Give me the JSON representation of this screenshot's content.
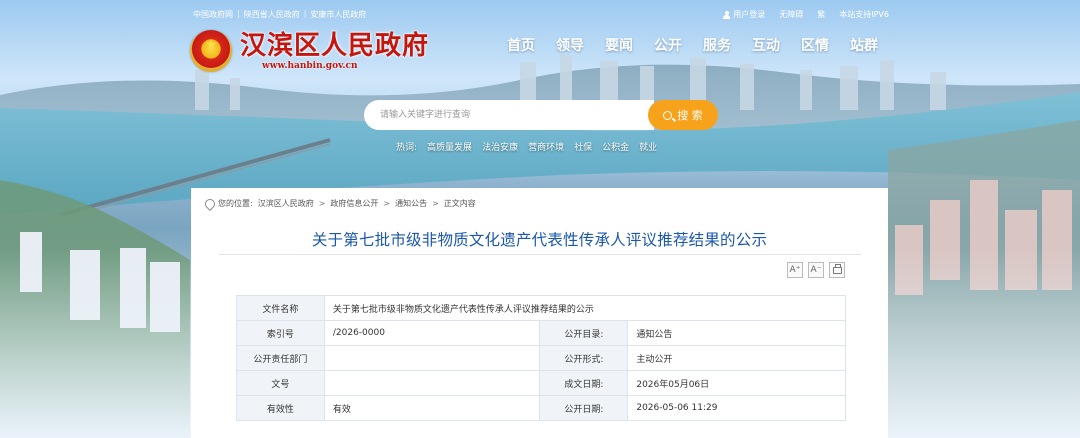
{
  "top_links": [
    "中国政府网",
    "陕西省人民政府",
    "安康市人民政府"
  ],
  "top_right": {
    "login": "用户登录",
    "accessible": "无障碍",
    "traditional": "繁",
    "ipv6": "本站支持IPV6"
  },
  "site": {
    "title": "汉滨区人民政府",
    "url": "www.hanbin.gov.cn"
  },
  "nav": [
    "首页",
    "领导",
    "要闻",
    "公开",
    "服务",
    "互动",
    "区情",
    "站群"
  ],
  "search": {
    "placeholder": "请输入关键字进行查询",
    "button": "搜 索"
  },
  "hotwords": {
    "label": "热词:",
    "items": [
      "高质量发展",
      "法治安康",
      "营商环境",
      "社保",
      "公积金",
      "就业"
    ]
  },
  "breadcrumb": {
    "label": "您的位置:",
    "items": [
      "汉滨区人民政府",
      "政府信息公开",
      "通知公告",
      "正文内容"
    ],
    "separator": ">"
  },
  "article": {
    "title": "关于第七批市级非物质文化遗产代表性传承人评议推荐结果的公示"
  },
  "tools": {
    "font_larger": "A⁺",
    "font_smaller": "A⁻"
  },
  "info": {
    "name_label": "文件名称",
    "name_value": "关于第七批市级非物质文化遗产代表性传承人评议推荐结果的公示",
    "index_label": "索引号",
    "index_value": "/2026-0000",
    "catalog_label": "公开目录:",
    "catalog_value": "通知公告",
    "dept_label": "公开责任部门",
    "dept_value": "",
    "form_label": "公开形式:",
    "form_value": "主动公开",
    "docno_label": "文号",
    "docno_value": "",
    "made_label": "成文日期:",
    "made_value": "2026年05月06日",
    "validity_label": "有效性",
    "validity_value": "有效",
    "pub_label": "公开日期:",
    "pub_value": "2026-05-06 11:29"
  },
  "colors": {
    "brand_red": "#c4160d",
    "accent_orange": "#f7a21b",
    "title_blue": "#1b57b0"
  }
}
